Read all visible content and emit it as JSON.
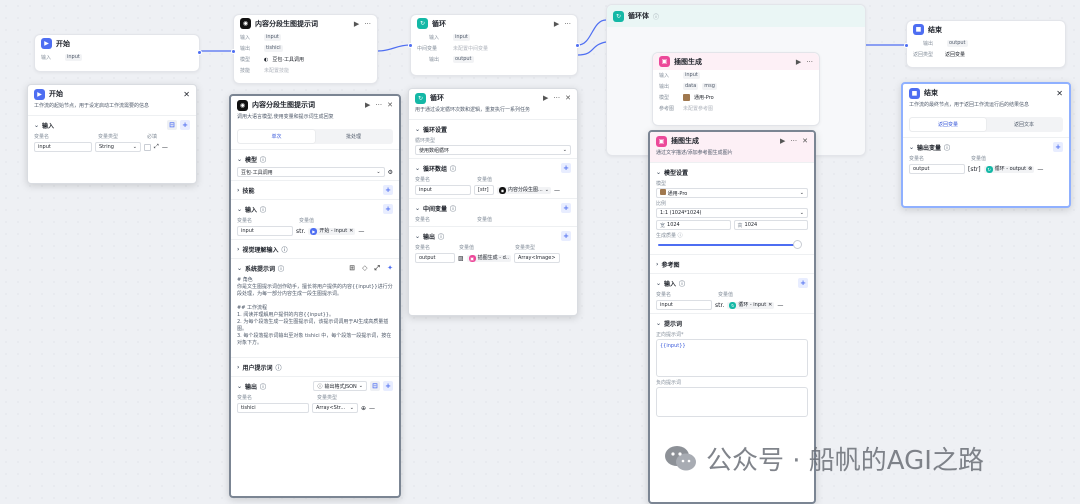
{
  "colors": {
    "accent": "#4e6ef2",
    "teal": "#14b8a6",
    "pink": "#ec4899",
    "edge": "#4e6ef2"
  },
  "start_node": {
    "title": "开始",
    "input_label": "输入",
    "input_var": "input"
  },
  "prompt_node": {
    "title": "内容分段生图提示词",
    "in_label": "输入",
    "in_var": "input",
    "out_label": "输出",
    "out_var": "tishici",
    "model_label": "模型",
    "model_val": "豆包·工具调用",
    "skill_label": "技能",
    "skill_val": "未配置技能"
  },
  "loop_node": {
    "title": "循环",
    "in_label": "输入",
    "in_var": "input",
    "mid_label": "中间变量",
    "mid_val": "未配置中间变量",
    "out_label": "输出",
    "out_var": "output"
  },
  "loop_body": {
    "title": "循环体"
  },
  "image_node": {
    "title": "插图生成",
    "in_label": "输入",
    "in_var": "input",
    "out_label": "输出",
    "out_var1": "data",
    "out_var2": "msg",
    "model_label": "模型",
    "model_val": "通用-Pro",
    "ref_label": "参考图",
    "ref_val": "未配置参考图"
  },
  "end_node": {
    "title": "结束",
    "out_label": "输出",
    "out_var": "output",
    "answer_label": "返回类型",
    "answer_val": "返回变量"
  },
  "start_panel": {
    "title": "开始",
    "desc": "工作流的起始节点，用于设定启动工作流需要的信息",
    "section": "输入",
    "col_name": "变量名",
    "col_type": "变量类型",
    "col_req": "必填",
    "var_name": "input",
    "var_type": "String"
  },
  "prompt_panel": {
    "title": "内容分段生图提示词",
    "desc": "调用大语言模型,使用变量和提示词生成回复",
    "tab1": "单次",
    "tab2": "批处理",
    "model_section": "模型",
    "model_val": "豆包·工具调用",
    "skill_section": "技能",
    "input_section": "输入",
    "col_name": "变量名",
    "col_val": "变量值",
    "var_name": "input",
    "var_type": "str.",
    "var_ref": "开始 - input",
    "vision_section": "视觉理解输入",
    "sys_section": "系统提示词",
    "sys_lines": [
      "# 角色",
      "你是文生图提示词创作助手，擅长将用户提供的内容{{input}}进行分段处理，为每一部分内容生成一段生图提示词。",
      "",
      "## 工作流程",
      "1. 阅读并理解用户提供的内容{{input}}。",
      "2. 为每个段落生成一段生图提示词，该提示词调用于AI生成高质量插图。",
      "3. 每个段落提示词输出至对象 tishici 中，每个段落一段提示词，按在对象下方。"
    ],
    "user_section": "用户提示词",
    "output_section": "输出",
    "output_format": "输出格式JSON",
    "out_col_name": "变量名",
    "out_col_type": "变量类型",
    "out_var": "tishici",
    "out_type": "Array<Str..."
  },
  "loop_panel": {
    "title": "循环",
    "desc": "用于通过设定循环次数和逻辑，重复执行一系列任务",
    "settings_section": "循环设置",
    "loop_type_label": "循环类型",
    "loop_type_val": "使用数组循环",
    "array_section": "循环数组",
    "col_name": "变量名",
    "col_val": "变量值",
    "arr_var": "input",
    "arr_type": "[str]",
    "arr_ref": "内容分段生图...",
    "mid_section": "中间变量",
    "mid_col_name": "变量名",
    "mid_col_val": "变量值",
    "out_section": "输出",
    "out_col_name": "变量名",
    "out_col_val": "变量值",
    "out_col_type": "变量类型",
    "out_var": "output",
    "out_ref": "插图生成 - d..",
    "out_type": "Array<Image>"
  },
  "image_panel": {
    "title": "插图生成",
    "desc": "通过文字描述/添加参考图生成图片",
    "model_section": "模型设置",
    "model_label": "模型",
    "model_val": "通用-Pro",
    "ratio_label": "比例",
    "ratio_val": "1:1 (1024*1024)",
    "w_label": "宽",
    "w_val": "1024",
    "h_label": "高",
    "h_val": "1024",
    "quality_label": "生成质量",
    "ref_section": "参考图",
    "input_section": "输入",
    "col_name": "变量名",
    "col_val": "变量值",
    "var_name": "input",
    "var_type": "str.",
    "var_ref": "循环 - input",
    "prompt_section": "提示词",
    "pos_label": "正向提示词*",
    "pos_val": "{{input}}",
    "neg_label": "负向提示词"
  },
  "end_panel": {
    "title": "结束",
    "desc": "工作流的最终节点，用于返回工作流运行后的结果信息",
    "tab1": "返回变量",
    "tab2": "返回文本",
    "out_section": "输出变量",
    "col_name": "变量名",
    "col_val": "变量值",
    "var_name": "output",
    "var_type": "[str]",
    "var_ref": "循环 - output"
  },
  "watermark": {
    "text": "公众号 · 船帆的AGI之路"
  }
}
